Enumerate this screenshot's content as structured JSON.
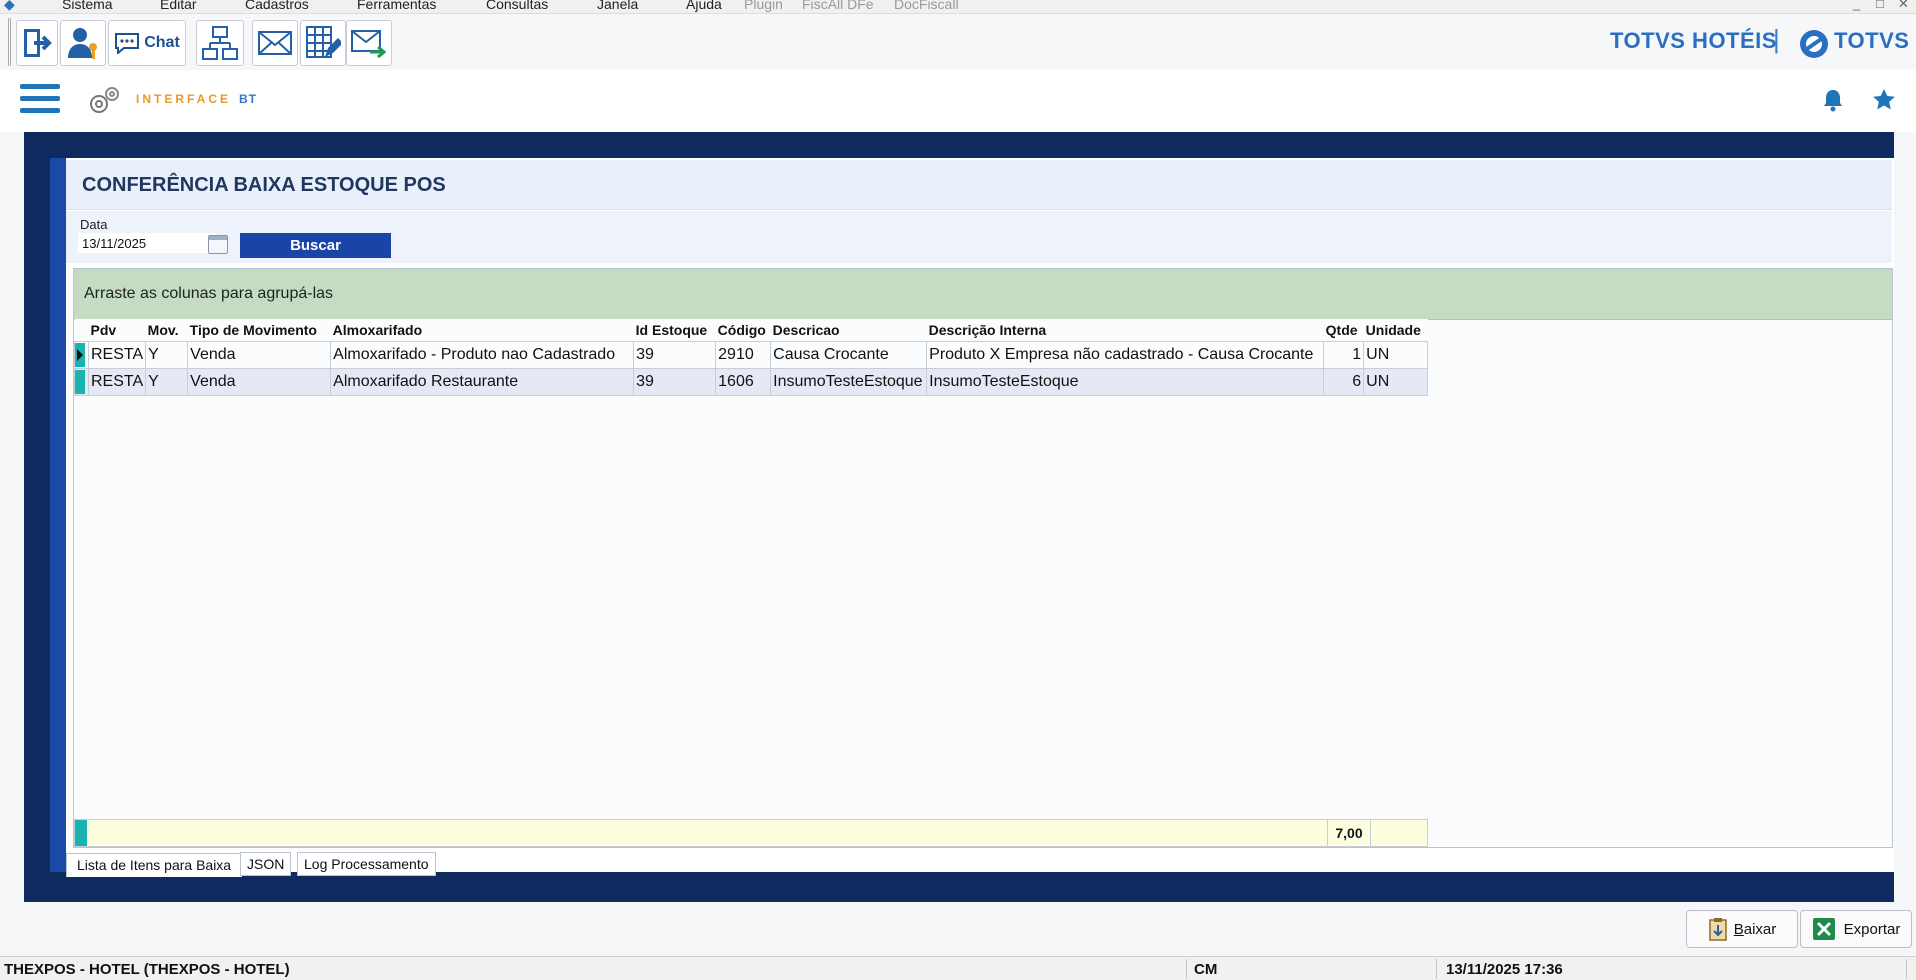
{
  "menubar": {
    "items": [
      "Sistema",
      "Editar",
      "Cadastros",
      "Ferramentas",
      "Consultas",
      "Janela",
      "Ajuda"
    ],
    "disabled_items": [
      "Plugin",
      "FiscAll DFe",
      "DocFiscall"
    ],
    "window_controls": [
      "_",
      "□",
      "✕"
    ]
  },
  "toolbar": {
    "chat_label": "Chat",
    "brand_hotel": "TOTVS HOTÉIS",
    "brand_divider": "|",
    "brand_totvs": "TOTVS"
  },
  "header": {
    "logo_text": "INTERFACE",
    "logo_suffix": "BT"
  },
  "page": {
    "title": "CONFERÊNCIA BAIXA ESTOQUE POS",
    "date_label": "Data",
    "date_value": "13/11/2025",
    "search_button": "Buscar"
  },
  "grid": {
    "group_hint": "Arraste as colunas para agrupá-las",
    "columns": [
      "Pdv",
      "Mov.",
      "Tipo de Movimento",
      "Almoxarifado",
      "Id Estoque",
      "Código",
      "Descricao",
      "Descrição Interna",
      "Qtde",
      "Unidade"
    ],
    "rows": [
      {
        "pdv": "RESTA",
        "mov": "Y",
        "tipo": "Venda",
        "almox": "Almoxarifado - Produto nao Cadastrado",
        "id_estoque": "39",
        "codigo": "2910",
        "descricao": "Causa Crocante",
        "descricao_interna": "Produto X Empresa não cadastrado - Causa Crocante",
        "qtde": "1",
        "unidade": "UN"
      },
      {
        "pdv": "RESTA",
        "mov": "Y",
        "tipo": "Venda",
        "almox": "Almoxarifado Restaurante",
        "id_estoque": "39",
        "codigo": "1606",
        "descricao": "InsumoTesteEstoque",
        "descricao_interna": "InsumoTesteEstoque",
        "qtde": "6",
        "unidade": "UN"
      }
    ],
    "total_qtde": "7,00"
  },
  "tabs": [
    "Lista de Itens para Baixa",
    "JSON",
    "Log Processamento"
  ],
  "actions": {
    "baixar_accel": "B",
    "baixar_rest": "aixar",
    "exportar": "Exportar"
  },
  "status": {
    "hotel": "THEXPOS - HOTEL (THEXPOS - HOTEL)",
    "user": "CM",
    "datetime": "13/11/2025 17:36"
  },
  "colors": {
    "frame": "#0f2a5e",
    "accent": "#1a45a8",
    "group_panel": "#c3dcc3",
    "row_indicator": "#19b3b0",
    "brand": "#2a6fc2"
  }
}
